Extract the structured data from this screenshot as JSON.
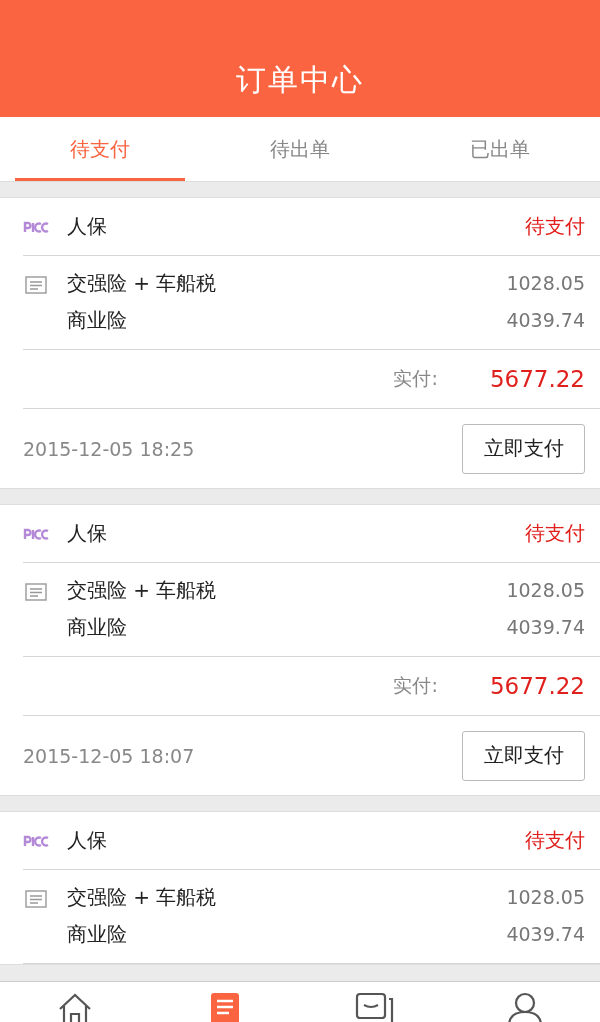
{
  "header": {
    "title": "订单中心"
  },
  "tabs": [
    {
      "label": "待支付",
      "selected": true
    },
    {
      "label": "待出单",
      "selected": false
    },
    {
      "label": "已出单",
      "selected": false
    }
  ],
  "orders": [
    {
      "insurer": "人保",
      "status": "待支付",
      "items": [
        {
          "name": "交强险 + 车船税",
          "amount": "1028.05"
        },
        {
          "name": "商业险",
          "amount": "4039.74"
        }
      ],
      "total_label": "实付:",
      "total": "5677.22",
      "time": "2015-12-05 18:25",
      "action": "立即支付"
    },
    {
      "insurer": "人保",
      "status": "待支付",
      "items": [
        {
          "name": "交强险 + 车船税",
          "amount": "1028.05"
        },
        {
          "name": "商业险",
          "amount": "4039.74"
        }
      ],
      "total_label": "实付:",
      "total": "5677.22",
      "time": "2015-12-05 18:07",
      "action": "立即支付"
    },
    {
      "insurer": "人保",
      "status": "待支付",
      "items": [
        {
          "name": "交强险 + 车船税",
          "amount": "1028.05"
        },
        {
          "name": "商业险",
          "amount": "4039.74"
        }
      ]
    }
  ],
  "nav": [
    {
      "kind": "home",
      "selected": false
    },
    {
      "kind": "orders",
      "selected": true
    },
    {
      "kind": "messages",
      "selected": false
    },
    {
      "kind": "profile",
      "selected": false
    }
  ]
}
